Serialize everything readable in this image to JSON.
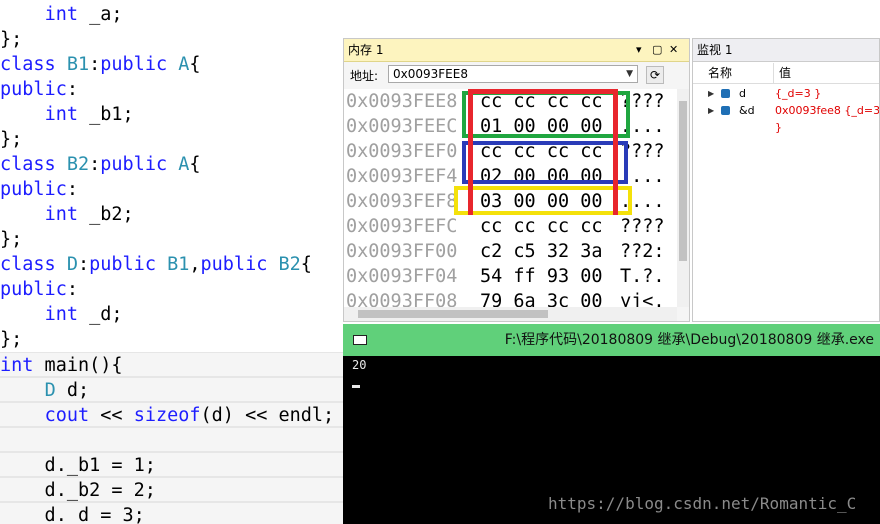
{
  "editor": {
    "lines": [
      {
        "parts": [
          {
            "t": "    "
          },
          {
            "t": "int",
            "c": "kw"
          },
          {
            "t": " _a;"
          }
        ]
      },
      {
        "parts": [
          {
            "t": "};"
          }
        ]
      },
      {
        "parts": [
          {
            "t": "class",
            "c": "kw"
          },
          {
            "t": " "
          },
          {
            "t": "B1",
            "c": "ty"
          },
          {
            "t": ":"
          },
          {
            "t": "public",
            "c": "kw"
          },
          {
            "t": " "
          },
          {
            "t": "A",
            "c": "ty"
          },
          {
            "t": "{"
          }
        ]
      },
      {
        "parts": [
          {
            "t": "public",
            "c": "kw"
          },
          {
            "t": ":"
          }
        ]
      },
      {
        "parts": [
          {
            "t": "    "
          },
          {
            "t": "int",
            "c": "kw"
          },
          {
            "t": " _b1;"
          }
        ]
      },
      {
        "parts": [
          {
            "t": "};"
          }
        ]
      },
      {
        "parts": [
          {
            "t": "class",
            "c": "kw"
          },
          {
            "t": " "
          },
          {
            "t": "B2",
            "c": "ty"
          },
          {
            "t": ":"
          },
          {
            "t": "public",
            "c": "kw"
          },
          {
            "t": " "
          },
          {
            "t": "A",
            "c": "ty"
          },
          {
            "t": "{"
          }
        ]
      },
      {
        "parts": [
          {
            "t": "public",
            "c": "kw"
          },
          {
            "t": ":"
          }
        ]
      },
      {
        "parts": [
          {
            "t": "    "
          },
          {
            "t": "int",
            "c": "kw"
          },
          {
            "t": " _b2;"
          }
        ]
      },
      {
        "parts": [
          {
            "t": "};"
          }
        ]
      },
      {
        "parts": [
          {
            "t": "class",
            "c": "kw"
          },
          {
            "t": " "
          },
          {
            "t": "D",
            "c": "ty"
          },
          {
            "t": ":"
          },
          {
            "t": "public",
            "c": "kw"
          },
          {
            "t": " "
          },
          {
            "t": "B1",
            "c": "ty"
          },
          {
            "t": ","
          },
          {
            "t": "public",
            "c": "kw"
          },
          {
            "t": " "
          },
          {
            "t": "B2",
            "c": "ty"
          },
          {
            "t": "{"
          }
        ]
      },
      {
        "parts": [
          {
            "t": "public",
            "c": "kw"
          },
          {
            "t": ":"
          }
        ]
      },
      {
        "parts": [
          {
            "t": "    "
          },
          {
            "t": "int",
            "c": "kw"
          },
          {
            "t": " _d;"
          }
        ]
      },
      {
        "parts": [
          {
            "t": "};"
          }
        ]
      },
      {
        "parts": [
          {
            "t": "int",
            "c": "kw"
          },
          {
            "t": " main(){"
          }
        ]
      },
      {
        "parts": [
          {
            "t": "    "
          },
          {
            "t": "D",
            "c": "ty"
          },
          {
            "t": " d;"
          }
        ]
      },
      {
        "parts": [
          {
            "t": "    "
          },
          {
            "t": "cout",
            "c": "kw"
          },
          {
            "t": " << "
          },
          {
            "t": "sizeof",
            "c": "kw"
          },
          {
            "t": "(d) << endl;"
          }
        ]
      },
      {
        "parts": [
          {
            "t": ""
          }
        ]
      },
      {
        "parts": [
          {
            "t": "    d._b1 = 1;"
          }
        ]
      },
      {
        "parts": [
          {
            "t": "    d._b2 = 2;"
          }
        ]
      },
      {
        "parts": [
          {
            "t": "    d._d = 3;"
          }
        ]
      }
    ]
  },
  "memory": {
    "title": "内存 1",
    "address_label": "地址:",
    "address_value": "0x0093FEE8",
    "rows": [
      {
        "addr": "0x0093FEE8",
        "bytes": "cc cc cc cc",
        "chars": "????"
      },
      {
        "addr": "0x0093FEEC",
        "bytes": "01 00 00 00",
        "chars": "...."
      },
      {
        "addr": "0x0093FEF0",
        "bytes": "cc cc cc cc",
        "chars": "????"
      },
      {
        "addr": "0x0093FEF4",
        "bytes": "02 00 00 00",
        "chars": "...."
      },
      {
        "addr": "0x0093FEF8",
        "bytes": "03 00 00 00",
        "chars": "...."
      },
      {
        "addr": "0x0093FEFC",
        "bytes": "cc cc cc cc",
        "chars": "????"
      },
      {
        "addr": "0x0093FF00",
        "bytes": "c2 c5 32 3a",
        "chars": "??2:"
      },
      {
        "addr": "0x0093FF04",
        "bytes": "54 ff 93 00",
        "chars": "T.?."
      },
      {
        "addr": "0x0093FF08",
        "bytes": "79 6a 3c 00",
        "chars": "yj<."
      }
    ]
  },
  "watch": {
    "title": "监视 1",
    "col_name": "名称",
    "col_value": "值",
    "rows": [
      {
        "name": "d",
        "value": "{_d=3 }"
      },
      {
        "name": "&d",
        "value": "0x0093fee8 {_d=3 }"
      }
    ]
  },
  "console": {
    "title": "F:\\程序代码\\20180809 继承\\Debug\\20180809 继承.exe",
    "output": "20"
  },
  "watermark": "https://blog.csdn.net/Romantic_C",
  "colors": {
    "keyword": "#1d1dff",
    "type": "#2b91af",
    "highlight_red": "#e8262d",
    "highlight_green": "#20a640",
    "highlight_blue": "#2a3bb8",
    "highlight_yellow": "#f4e10a"
  }
}
